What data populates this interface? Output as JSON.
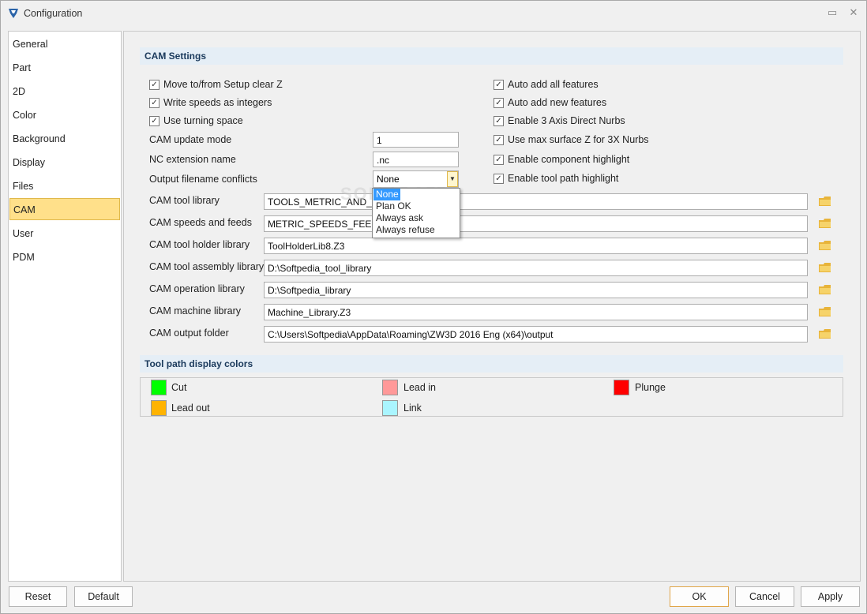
{
  "window": {
    "title": "Configuration"
  },
  "sidebar": {
    "items": [
      {
        "label": "General"
      },
      {
        "label": "Part"
      },
      {
        "label": "2D"
      },
      {
        "label": "Color"
      },
      {
        "label": "Background"
      },
      {
        "label": "Display"
      },
      {
        "label": "Files"
      },
      {
        "label": "CAM",
        "active": true
      },
      {
        "label": "User"
      },
      {
        "label": "PDM"
      }
    ]
  },
  "cam_settings": {
    "header": "CAM Settings",
    "left_checks": [
      {
        "label": "Move to/from Setup clear Z",
        "checked": true
      },
      {
        "label": "Write speeds as integers",
        "checked": true
      },
      {
        "label": "Use turning space",
        "checked": true
      }
    ],
    "right_checks": [
      {
        "label": "Auto add all features",
        "checked": true
      },
      {
        "label": "Auto add new features",
        "checked": true
      },
      {
        "label": "Enable 3 Axis Direct Nurbs",
        "checked": true
      },
      {
        "label": "Use max surface Z for 3X Nurbs",
        "checked": true
      },
      {
        "label": "Enable component highlight",
        "checked": true
      },
      {
        "label": "Enable tool path highlight",
        "checked": true
      }
    ],
    "update_mode": {
      "label": "CAM update mode",
      "value": "1"
    },
    "nc_extension": {
      "label": "NC extension name",
      "value": ".nc"
    },
    "filename_conflicts": {
      "label": "Output filename conflicts",
      "value": "None",
      "options": [
        "None",
        "Plan OK",
        "Always ask",
        "Always refuse"
      ]
    },
    "paths": [
      {
        "label": "CAM tool library",
        "value": "TOOLS_METRIC_AND_INC"
      },
      {
        "label": "CAM speeds and feeds",
        "value": "METRIC_SPEEDS_FEEDS.Z"
      },
      {
        "label": "CAM tool holder library",
        "value": "ToolHolderLib8.Z3"
      },
      {
        "label": "CAM tool assembly library",
        "value": "D:\\Softpedia_tool_library"
      },
      {
        "label": "CAM operation library",
        "value": "D:\\Softpedia_library"
      },
      {
        "label": "CAM machine library",
        "value": "Machine_Library.Z3"
      },
      {
        "label": "CAM output folder",
        "value": "C:\\Users\\Softpedia\\AppData\\Roaming\\ZW3D 2016 Eng (x64)\\output"
      }
    ]
  },
  "tool_path_colors": {
    "header": "Tool path display colors",
    "items": [
      {
        "label": "Cut",
        "color": "#00ff00"
      },
      {
        "label": "Lead in",
        "color": "#ff9999"
      },
      {
        "label": "Plunge",
        "color": "#ff0000"
      },
      {
        "label": "Lead out",
        "color": "#ffb300"
      },
      {
        "label": "Link",
        "color": "#aaf5ff"
      }
    ]
  },
  "buttons": {
    "reset": "Reset",
    "default": "Default",
    "ok": "OK",
    "cancel": "Cancel",
    "apply": "Apply"
  },
  "watermark": "SOFTPEDIA"
}
